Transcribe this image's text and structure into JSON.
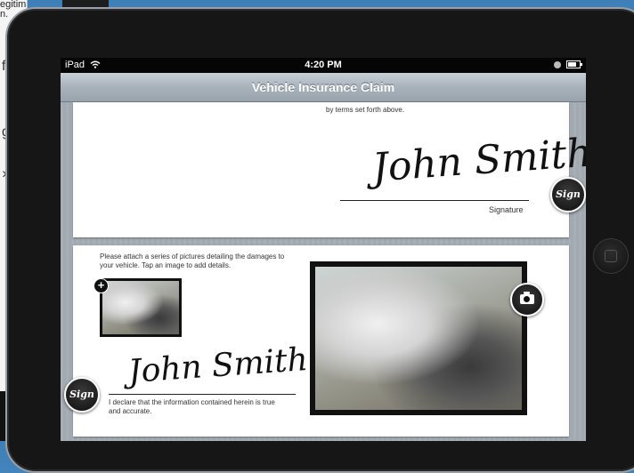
{
  "background": {
    "document_text": "egitimate\nn."
  },
  "statusbar": {
    "device": "iPad",
    "time": "4:20 PM"
  },
  "navbar": {
    "title": "Vehicle Insurance Claim"
  },
  "card1": {
    "terms_text": "by terms set forth above.",
    "signature_script": "John Smith",
    "signature_label": "Signature",
    "sign_button_label": "Sign"
  },
  "card2": {
    "instructions": "Please attach a series of pictures detailing the damages to your vehicle. Tap an image to add details.",
    "add_photo_label": "+",
    "signature_script": "John Smith",
    "declaration": "I declare that the information contained herein is true and accurate.",
    "sign_button_label": "Sign"
  },
  "icons": {
    "wifi": "wifi-icon",
    "lock": "lock-icon",
    "battery": "battery-icon",
    "camera": "camera-icon",
    "add": "plus-icon"
  }
}
